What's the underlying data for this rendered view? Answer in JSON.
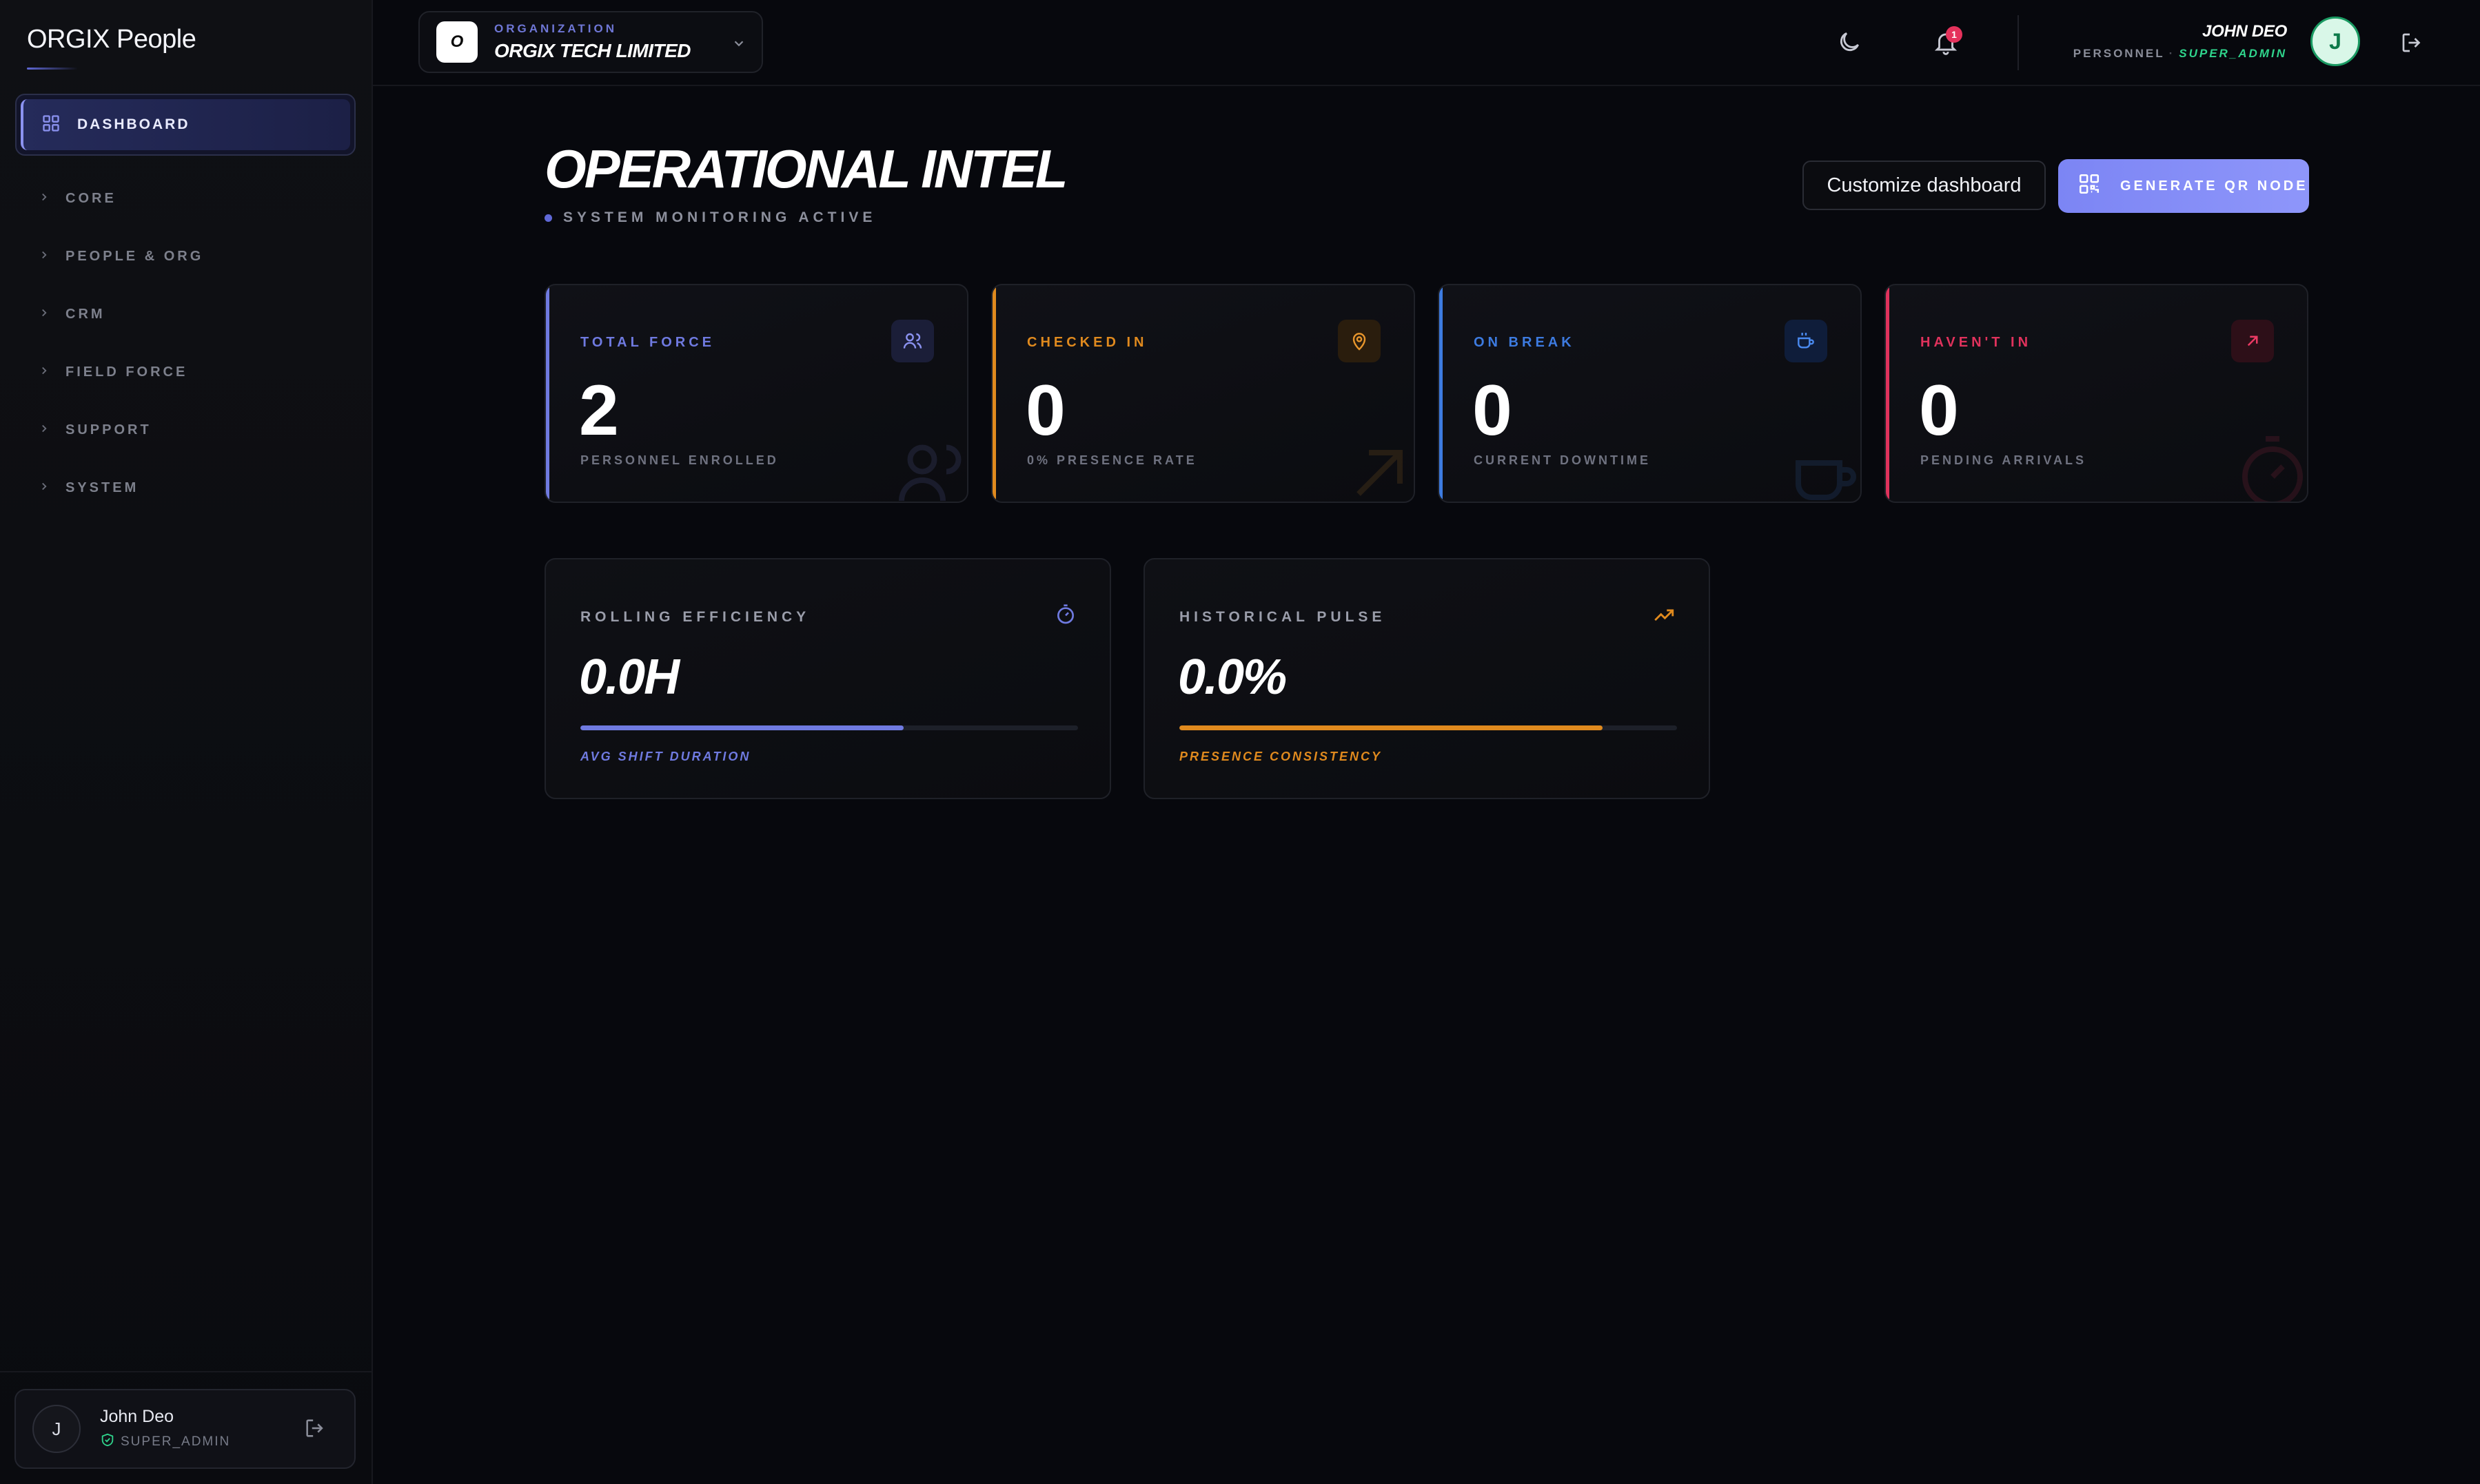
{
  "sidebar": {
    "brand": "ORGIX People",
    "active_item": {
      "label": "DASHBOARD",
      "icon": "grid-icon"
    },
    "groups": [
      {
        "label": "CORE"
      },
      {
        "label": "PEOPLE & ORG"
      },
      {
        "label": "CRM"
      },
      {
        "label": "FIELD FORCE"
      },
      {
        "label": "SUPPORT"
      },
      {
        "label": "SYSTEM"
      }
    ],
    "user": {
      "initial": "J",
      "name": "John Deo",
      "role": "SUPER_ADMIN"
    }
  },
  "topbar": {
    "org_kicker": "ORGANIZATION",
    "org_name": "ORGIX TECH LIMITED",
    "org_logo_letter": "O",
    "notification_count": "1",
    "user_name": "JOHN DEO",
    "user_label": "PERSONNEL",
    "user_separator": "·",
    "user_role": "SUPER_ADMIN",
    "user_initial": "J"
  },
  "header": {
    "title": "OPERATIONAL INTEL",
    "status": "SYSTEM MONITORING ACTIVE",
    "customize_label": "Customize dashboard",
    "qr_label": "GENERATE QR NODE"
  },
  "stats": [
    {
      "label": "TOTAL FORCE",
      "value": "2",
      "sub": "PERSONNEL ENROLLED",
      "color": "#6f7ae0",
      "icon": "users-icon"
    },
    {
      "label": "CHECKED IN",
      "value": "0",
      "sub": "0% PRESENCE RATE",
      "color": "#e08a1e",
      "icon": "map-pin-icon"
    },
    {
      "label": "ON BREAK",
      "value": "0",
      "sub": "CURRENT DOWNTIME",
      "color": "#3d7be0",
      "icon": "coffee-icon"
    },
    {
      "label": "HAVEN'T IN",
      "value": "0",
      "sub": "PENDING ARRIVALS",
      "color": "#e0325c",
      "icon": "arrow-up-right-icon"
    }
  ],
  "metrics": [
    {
      "label": "ROLLING EFFICIENCY",
      "value": "0.0H",
      "sub": "AVG SHIFT DURATION",
      "progress": 0.65,
      "color": "#6f7ae0",
      "icon": "stopwatch-icon"
    },
    {
      "label": "HISTORICAL PULSE",
      "value": "0.0%",
      "sub": "PRESENCE CONSISTENCY",
      "progress": 0.85,
      "color": "#e08a1e",
      "icon": "trending-up-icon"
    }
  ],
  "colors": {
    "accent": "#7c85f4",
    "success": "#2fd48c",
    "danger": "#e5325c",
    "background": "#07080d"
  }
}
